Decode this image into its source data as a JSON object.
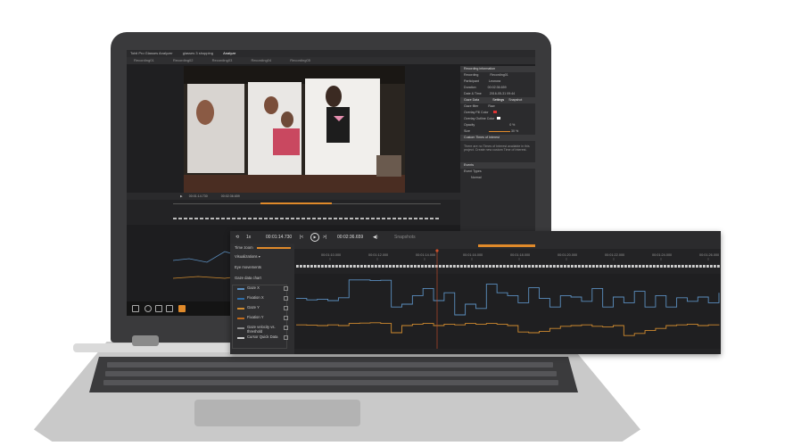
{
  "app": {
    "window_title": "Tobii Pro Glasses Analyzer",
    "project_tab": "glasses 3 shopping",
    "analyze_tab": "Analyze",
    "recording_tabs": [
      "Recording01",
      "Recording02",
      "Recording03",
      "Recording04",
      "Recording05"
    ]
  },
  "right_panel": {
    "recording_info_title": "Recording information",
    "recording_label": "Recording",
    "recording_value": "Recording01",
    "participant_label": "Participant",
    "participant_value": "Leonora",
    "duration_label": "Duration",
    "duration_value": "00:02:36.659",
    "date_label": "Date & Time",
    "date_value": "2016-05-31 09:44",
    "gaze_data_title": "Gaze Data",
    "settings_tab": "Settings",
    "snapshot_tab": "Snapshot",
    "gaze_filter_label": "Gaze filter",
    "gaze_filter_value": "Raw",
    "overlay_fill_label": "Overlay Fill Color",
    "overlay_outline_label": "Overlay Outline Color",
    "opacity_label": "Opacity",
    "opacity_value": "0 %",
    "size_label": "Size",
    "size_value": "30 %",
    "custom_toi_title": "Custom Times of Interest",
    "custom_toi_msg": "There are no Times of Interest available in this project. Create new custom Time of Interest.",
    "events_title": "Events",
    "event_types_label": "Event Types",
    "event_types_value": "Normal"
  },
  "zoom": {
    "speed_label": "1x",
    "current_time": "00:01:14.730",
    "end_time": "00:02:36.659",
    "snapshots_label": "Snapshots",
    "time_zoom_label": "Time zoom",
    "visualizations_label": "Visualizations",
    "eye_movements_label": "Eye movements",
    "gaze_chart_label": "Gaze data chart",
    "ticks": [
      "00:01:10.000",
      "00:01:12.000",
      "00:01:14.000",
      "00:01:16.000",
      "00:01:18.000",
      "00:01:20.000",
      "00:01:22.000",
      "00:01:24.000",
      "00:01:26.000"
    ],
    "legend": [
      {
        "label": "Gaze X",
        "color": "#5b8fc0"
      },
      {
        "label": "Fixation X",
        "color": "#2e6da8"
      },
      {
        "label": "Gaze Y",
        "color": "#d08b2f"
      },
      {
        "label": "Fixation Y",
        "color": "#c06a1c"
      },
      {
        "label": "Gaze velocity vs. threshold",
        "color": "#888888"
      },
      {
        "label": "Cursor Quick Data",
        "color": "#cccccc"
      }
    ],
    "y_ticks": [
      "1000",
      "800",
      "600",
      "400",
      "200",
      "0",
      "400"
    ]
  },
  "chart_data": {
    "type": "line",
    "xlabel": "",
    "ylabel": "",
    "x": [
      0,
      1,
      2,
      3,
      4,
      5,
      6,
      7,
      8,
      9,
      10,
      11,
      12,
      13,
      14,
      15,
      16,
      17,
      18,
      19,
      20,
      21,
      22,
      23,
      24,
      25,
      26,
      27,
      28,
      29,
      30,
      31,
      32,
      33,
      34,
      35,
      36,
      37,
      38,
      39,
      40
    ],
    "series": [
      {
        "name": "Gaze X",
        "values": [
          680,
          660,
          670,
          650,
          690,
          940,
          940,
          930,
          935,
          560,
          600,
          720,
          820,
          650,
          760,
          450,
          600,
          540,
          880,
          760,
          720,
          620,
          830,
          680,
          560,
          720,
          700,
          640,
          820,
          560,
          700,
          620,
          780,
          560,
          720,
          560,
          690,
          640,
          700,
          620,
          760
        ]
      },
      {
        "name": "Gaze Y",
        "values": [
          310,
          305,
          300,
          310,
          300,
          330,
          335,
          340,
          330,
          200,
          300,
          320,
          330,
          300,
          320,
          310,
          330,
          320,
          330,
          320,
          300,
          210,
          200,
          220,
          260,
          290,
          300,
          310,
          290,
          280,
          300,
          160,
          190,
          230,
          260,
          300,
          310,
          320,
          300,
          310,
          305
        ]
      }
    ],
    "ylim": [
      0,
      1000
    ]
  }
}
